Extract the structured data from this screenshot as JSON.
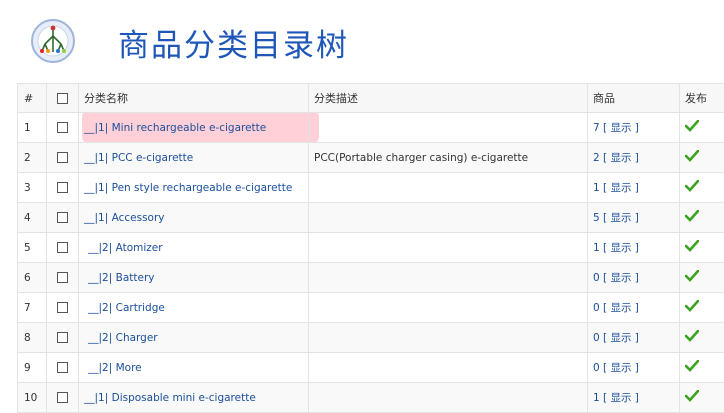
{
  "header": {
    "title": "商品分类目录树"
  },
  "table": {
    "columns": {
      "num": "#",
      "name": "分类名称",
      "desc": "分类描述",
      "products": "商品",
      "publish": "发布"
    },
    "rows": [
      {
        "num": "1",
        "prefix": "__|1|",
        "name": "Mini rechargeable e-cigarette",
        "desc": "",
        "count": "7",
        "show": "[ 显示 ]"
      },
      {
        "num": "2",
        "prefix": "__|1|",
        "name": "PCC e-cigarette",
        "desc": "PCC(Portable charger casing) e-cigarette",
        "count": "2",
        "show": "[ 显示 ]"
      },
      {
        "num": "3",
        "prefix": "__|1|",
        "name": "Pen style rechargeable e-cigarette",
        "desc": "",
        "count": "1",
        "show": "[ 显示 ]"
      },
      {
        "num": "4",
        "prefix": "__|1|",
        "name": "Accessory",
        "desc": "",
        "count": "5",
        "show": "[ 显示 ]"
      },
      {
        "num": "5",
        "prefix": "__|2|",
        "name": "Atomizer",
        "desc": "",
        "count": "1",
        "show": "[ 显示 ]"
      },
      {
        "num": "6",
        "prefix": "__|2|",
        "name": "Battery",
        "desc": "",
        "count": "0",
        "show": "[ 显示 ]"
      },
      {
        "num": "7",
        "prefix": "__|2|",
        "name": "Cartridge",
        "desc": "",
        "count": "0",
        "show": "[ 显示 ]"
      },
      {
        "num": "8",
        "prefix": "__|2|",
        "name": "Charger",
        "desc": "",
        "count": "0",
        "show": "[ 显示 ]"
      },
      {
        "num": "9",
        "prefix": "__|2|",
        "name": "More",
        "desc": "",
        "count": "0",
        "show": "[ 显示 ]"
      },
      {
        "num": "10",
        "prefix": "__|1|",
        "name": "Disposable mini e-cigarette",
        "desc": "",
        "count": "1",
        "show": "[ 显示 ]"
      }
    ]
  },
  "icons": {
    "logo": "tree-logo-icon",
    "publish": "checkmark-icon",
    "checkbox": "checkbox-icon"
  },
  "colors": {
    "title": "#1f57b8",
    "link": "#1a4e9a",
    "check": "#3aa31f",
    "highlight": "#ff788c"
  }
}
